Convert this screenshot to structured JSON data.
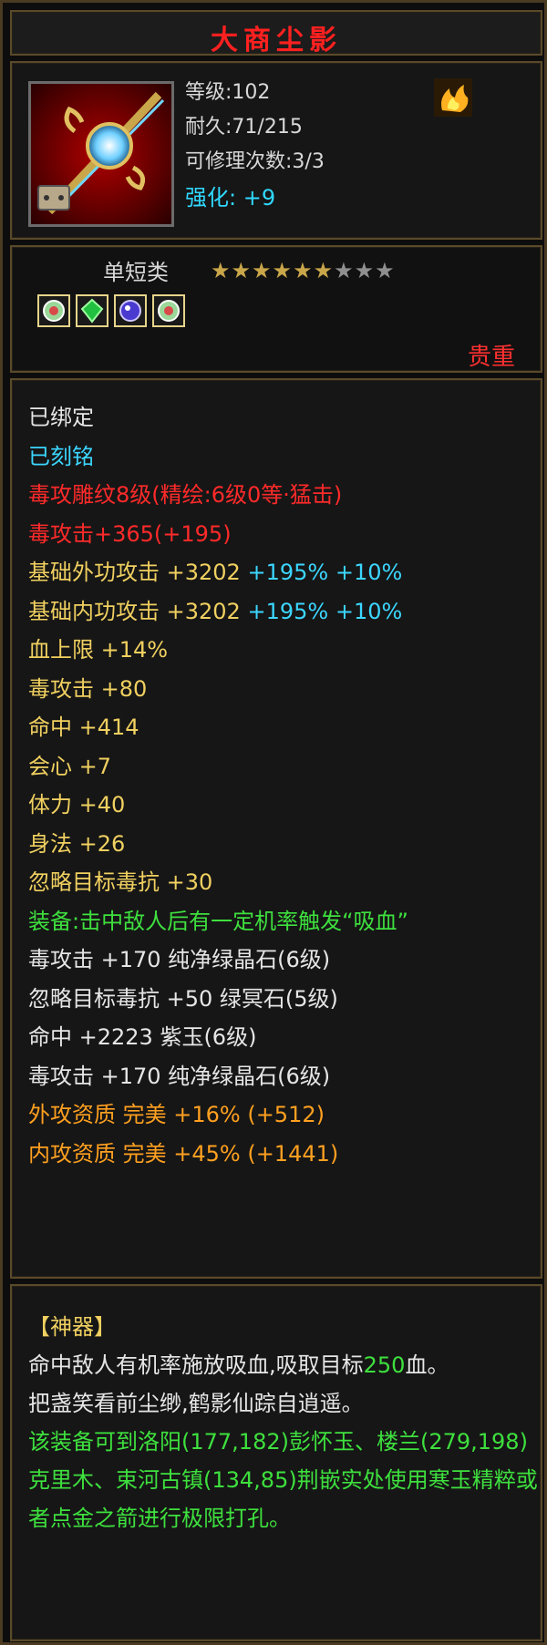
{
  "title": "大商尘影",
  "stats": {
    "level": "等级:102",
    "durability": "耐久:71/215",
    "repairs": "可修理次数:3/3",
    "enhance_label": "强化:",
    "enhance_value": "+9"
  },
  "icons": {
    "item": "sword-icon",
    "corner": "fire-badge-icon",
    "gems": [
      "jade-gem-icon",
      "green-crystal-gem-icon",
      "purple-gem-icon",
      "jade-gem-icon"
    ]
  },
  "info": {
    "weapon_class": "单短类",
    "stars_filled": 6,
    "stars_total": 9,
    "rarity": "贵重"
  },
  "attributes": {
    "bound": "已绑定",
    "engraved": "已刻铭",
    "poison_pattern": "毒攻雕纹8级(精绘:6级0等·猛击)",
    "poison_attack_base": "毒攻击+365(+195)",
    "base_external": {
      "text": "基础外功攻击 +3202",
      "pct1": "+195%",
      "pct2": "+10%"
    },
    "base_internal": {
      "text": "基础内功攻击 +3202",
      "pct1": "+195%",
      "pct2": "+10%"
    },
    "hp_max": "血上限 +14%",
    "poison_attack": "毒攻击 +80",
    "hit": "命中 +414",
    "crit": "会心 +7",
    "stamina": "体力 +40",
    "agility": "身法 +26",
    "ignore_poison_res": "忽略目标毒抗 +30",
    "equip_effect": "装备:击中敌人后有一定机率触发“吸血”",
    "gem_lines": [
      "毒攻击 +170 纯净绿晶石(6级)",
      "忽略目标毒抗 +50 绿冥石(5级)",
      "命中 +2223 紫玉(6级)",
      "毒攻击 +170 纯净绿晶石(6级)"
    ],
    "external_quality": "外攻资质  完美 +16% (+512)",
    "internal_quality": "内攻资质  完美 +45% (+1441)"
  },
  "artifact": {
    "header": "【神器】",
    "effect_text": "命中敌人有机率施放吸血,吸取目标",
    "effect_value": "250",
    "effect_suffix": "血。",
    "poem": "把盏笑看前尘缈,鹤影仙踪自逍遥。",
    "location_note": "该装备可到洛阳(177,182)彭怀玉、楼兰(279,198)克里木、束河古镇(134,85)荆嵌实处使用寒玉精粹或者点金之箭进行极限打孔。"
  },
  "colors": {
    "title": "#ff2020",
    "cyan": "#3cd6ff",
    "red": "#ff2a2a",
    "yellow": "#f0d060",
    "green": "#3ee03e",
    "orange": "#ffa020",
    "frame": "#5a4a2a"
  }
}
